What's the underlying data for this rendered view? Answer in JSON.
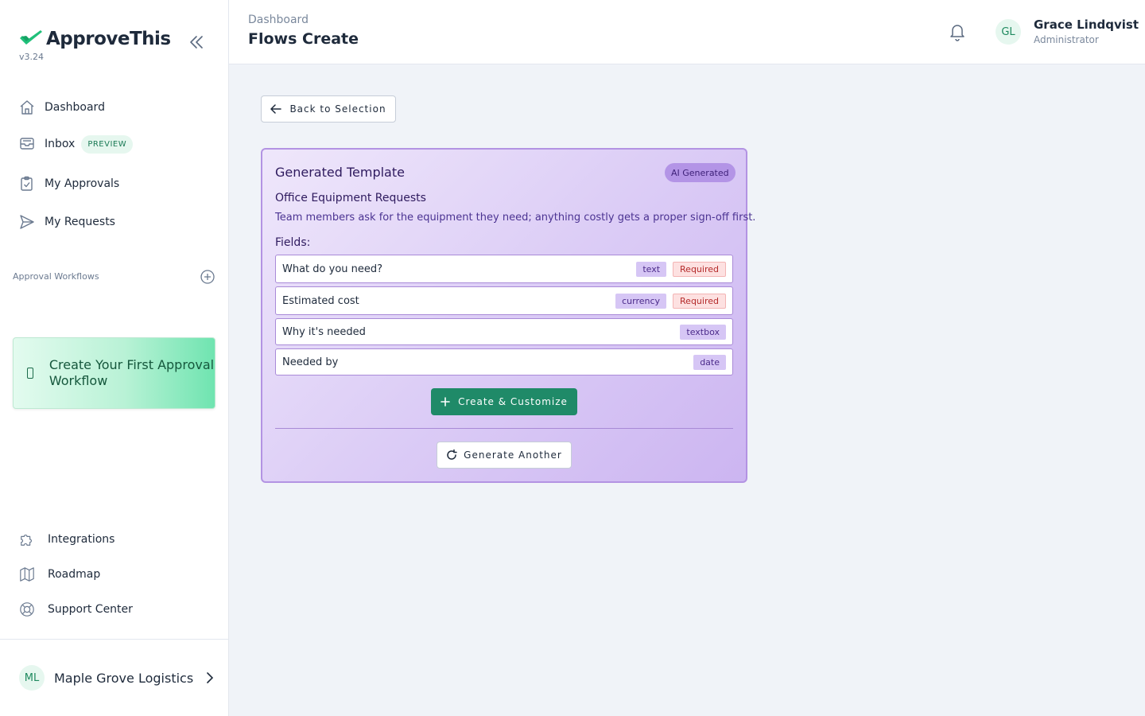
{
  "app": {
    "name": "ApproveThis",
    "version": "v3.24"
  },
  "sidebar": {
    "nav": [
      {
        "label": "Dashboard",
        "icon": "home-icon"
      },
      {
        "label": "Inbox",
        "icon": "inbox-icon",
        "badge": "PREVIEW"
      },
      {
        "label": "My Approvals",
        "icon": "clipboard-check-icon"
      },
      {
        "label": "My Requests",
        "icon": "send-icon"
      }
    ],
    "section_title": "Approval Workflows",
    "cta": "Create Your First Approval Workflow",
    "bottom_nav": [
      {
        "label": "Integrations",
        "icon": "puzzle-icon"
      },
      {
        "label": "Roadmap",
        "icon": "map-icon"
      },
      {
        "label": "Support Center",
        "icon": "lifebuoy-icon"
      }
    ],
    "org": {
      "initials": "ML",
      "name": "Maple Grove Logistics"
    }
  },
  "header": {
    "breadcrumb": "Dashboard",
    "title": "Flows Create",
    "user": {
      "initials": "GL",
      "name": "Grace Lindqvist",
      "role": "Administrator"
    }
  },
  "main": {
    "back_label": "Back to Selection",
    "template": {
      "heading": "Generated Template",
      "badge": "AI Generated",
      "name": "Office Equipment Requests",
      "description": "Team members ask for the equipment they need; anything costly gets a proper sign-off first.",
      "fields_label": "Fields:",
      "fields": [
        {
          "name": "What do you need?",
          "type": "text",
          "required": "Required"
        },
        {
          "name": "Estimated cost",
          "type": "currency",
          "required": "Required"
        },
        {
          "name": "Why it's needed",
          "type": "textbox"
        },
        {
          "name": "Needed by",
          "type": "date"
        }
      ],
      "create_label": "Create & Customize",
      "regenerate_label": "Generate Another"
    }
  },
  "colors": {
    "brand": "#20c07a",
    "primary_button": "#1f8a68",
    "template_border": "#b393e3",
    "required": "#b42a2a"
  }
}
